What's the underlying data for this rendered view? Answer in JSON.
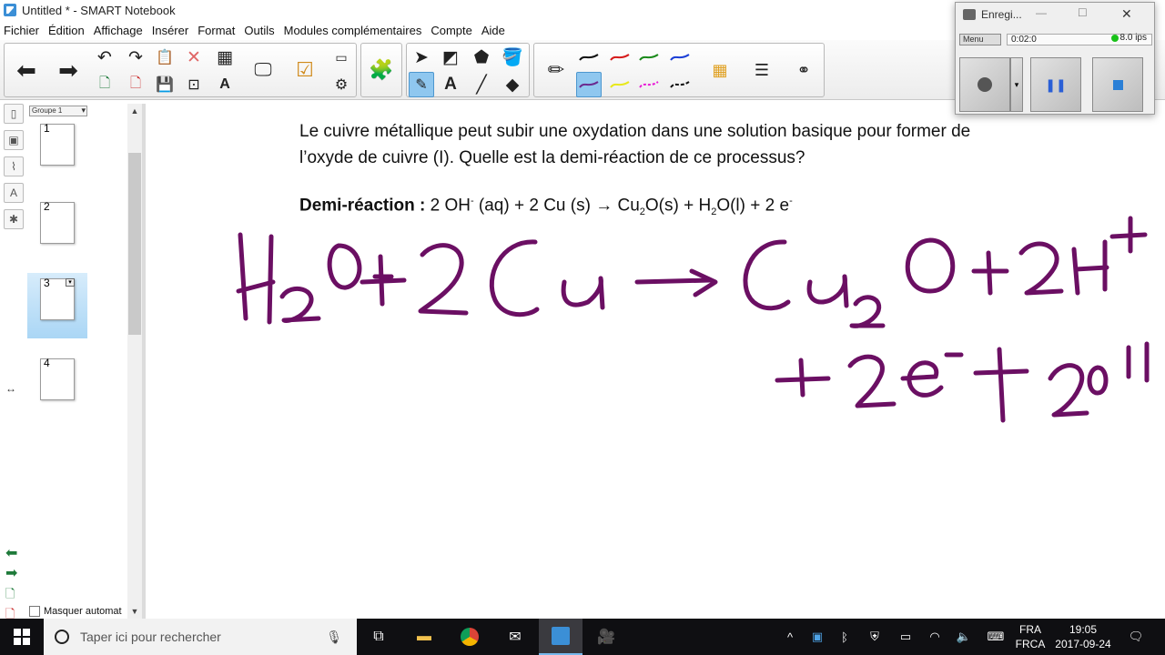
{
  "window": {
    "title": "Untitled * - SMART Notebook"
  },
  "menu": [
    "Fichier",
    "Édition",
    "Affichage",
    "Insérer",
    "Format",
    "Outils",
    "Modules complémentaires",
    "Compte",
    "Aide"
  ],
  "sorter": {
    "group_label": "Groupe 1",
    "pages": [
      "1",
      "2",
      "3",
      "4"
    ],
    "selected_page": "3",
    "auto_hide_label": "Masquer automat"
  },
  "page": {
    "question": "Le cuivre métallique peut subir une oxydation dans une solution basique pour former de l’oxyde de cuivre (I). Quelle est la demi-réaction de ce processus?",
    "half_reaction_label": "Demi-réaction :",
    "half_reaction_parts": {
      "p1": "2 OH",
      "p1_sup": "-",
      "p2": " (aq) + 2 Cu (s) →  Cu",
      "p2_sub": "2",
      "p3": "O(s) + H",
      "p3_sub": "2",
      "p4": "O(l) + 2 e",
      "p4_sup": "-"
    },
    "ink_color": "#6b0f63"
  },
  "recorder": {
    "title": "Enregi...",
    "menu_label": "Menu",
    "time": "0:02:0",
    "fps": "8.0 ips",
    "status_color": "#19c219"
  },
  "taskbar": {
    "search_placeholder": "Taper ici pour rechercher",
    "lang_top": "FRA",
    "lang_bottom": "FRCA",
    "time": "19:05",
    "date": "2017-09-24"
  },
  "colors": {
    "pen_black": "#111111",
    "pen_red": "#d61b1b",
    "pen_green": "#1b8a1b",
    "pen_blue": "#1b3fd6",
    "pen_purple": "#6b2a8f",
    "pen_yellow": "#e8e81b",
    "pen_pink": "#e81bd6"
  }
}
